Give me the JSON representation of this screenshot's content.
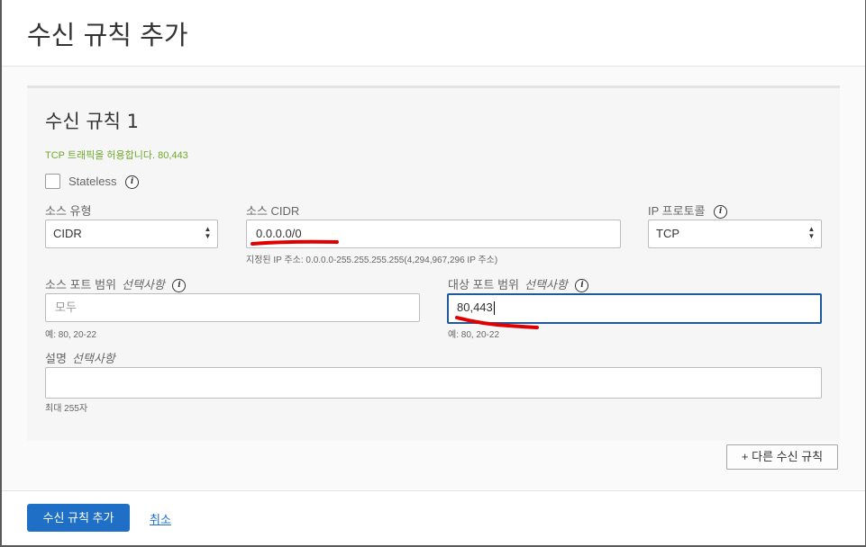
{
  "dialog": {
    "title": "수신 규칙 추가"
  },
  "rule": {
    "title": "수신 규칙 1",
    "allowed_message": "TCP 트래픽을 허용합니다. 80,443",
    "stateless_label": "Stateless",
    "stateless_checked": false,
    "source_type": {
      "label": "소스 유형",
      "value": "CIDR"
    },
    "source_cidr": {
      "label": "소스 CIDR",
      "value": "0.0.0.0/0",
      "hint": "지정된 IP 주소: 0.0.0.0-255.255.255.255(4,294,967,296 IP 주소)"
    },
    "ip_protocol": {
      "label": "IP 프로토콜",
      "value": "TCP"
    },
    "source_port": {
      "label": "소스 포트 범위",
      "optional": "선택사항",
      "placeholder": "모두",
      "value": "",
      "hint": "예: 80, 20-22"
    },
    "dest_port": {
      "label": "대상 포트 범위",
      "optional": "선택사항",
      "value": "80,443",
      "hint": "예: 80, 20-22"
    },
    "description": {
      "label": "설명",
      "optional": "선택사항",
      "value": "",
      "hint": "최대 255자"
    }
  },
  "another_rule_button": "+ 다른 수신 규칙",
  "footer": {
    "submit_label": "수신 규칙 추가",
    "cancel_label": "취소"
  },
  "colors": {
    "primary": "#1f6fc7",
    "success_text": "#6fa82c",
    "focus_border": "#1f5b9c",
    "annotation_red": "#e00000"
  },
  "icons": {
    "info": "info-icon",
    "select_arrows": "chevron-updown-icon"
  }
}
